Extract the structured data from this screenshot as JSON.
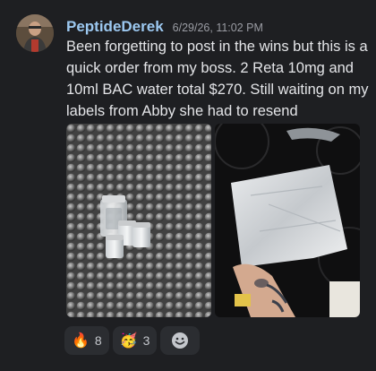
{
  "message": {
    "username": "PeptideDerek",
    "timestamp": "6/29/26, 11:02 PM",
    "text": "Been forgetting to post in the wins but this is a quick order from my boss. 2 Reta 10mg and 10ml BAC water total $270. Still waiting on my labels from Abby she had to resend"
  },
  "attachments": [
    {
      "icon": "photo-vials-on-bubble-wrap"
    },
    {
      "icon": "photo-hand-holding-package"
    }
  ],
  "reactions": [
    {
      "icon": "fire-emoji",
      "emoji": "🔥",
      "count": "8"
    },
    {
      "icon": "party-face-emoji",
      "emoji": "🥳",
      "count": "3"
    }
  ],
  "add_reaction": {
    "icon": "smiley-icon",
    "glyph": "☺"
  },
  "colors": {
    "background": "#1e1f22",
    "username": "#9cc8f0",
    "reaction_bg": "#2b2d31"
  }
}
